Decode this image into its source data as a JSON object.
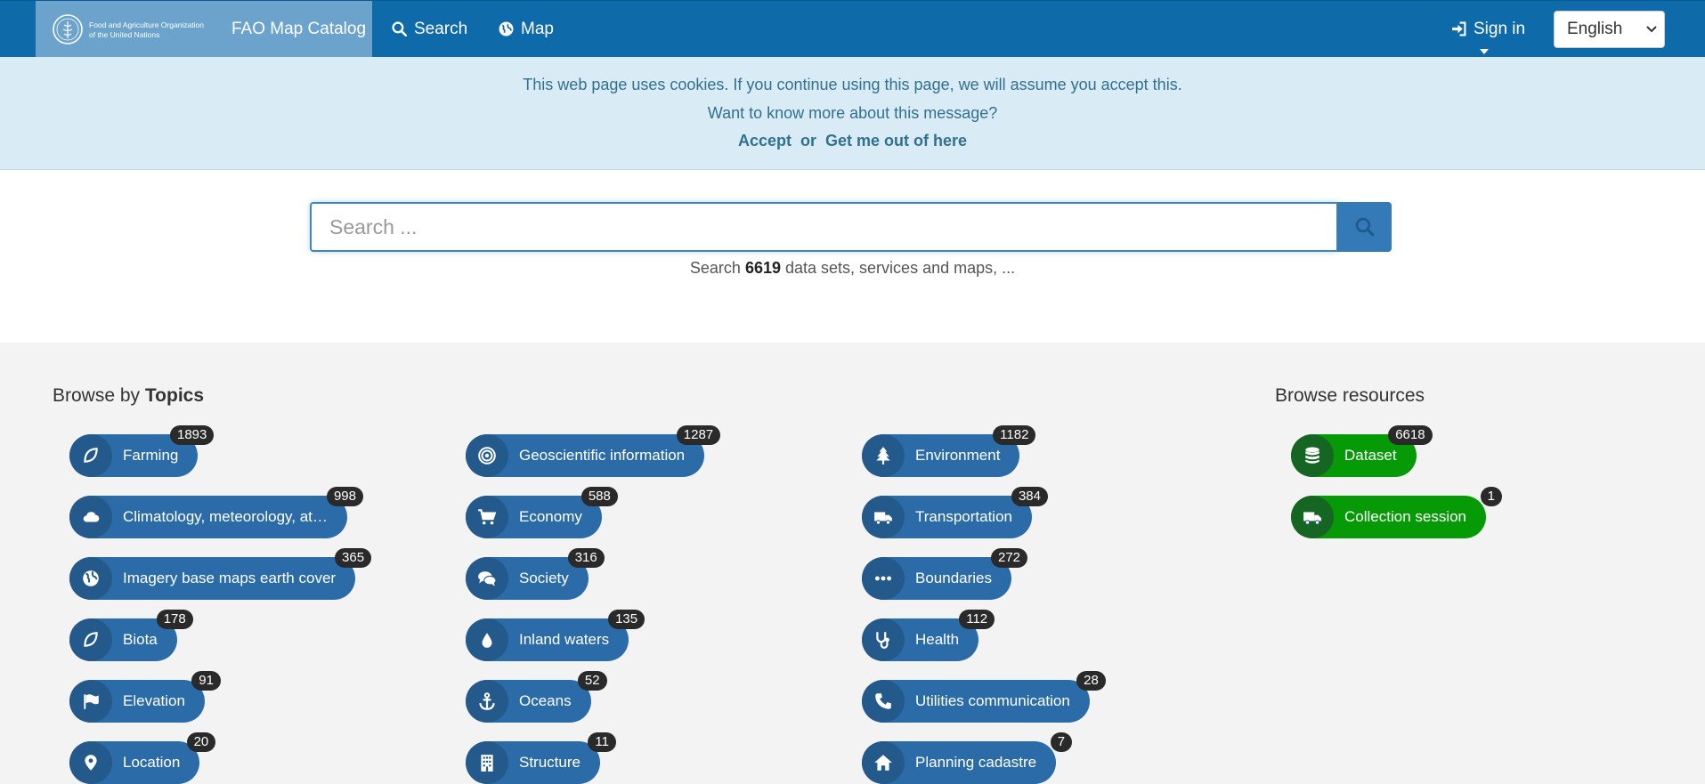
{
  "nav": {
    "org_name_line1": "Food and Agriculture Organization",
    "org_name_line2": "of the United Nations",
    "brand_title": "FAO Map Catalog",
    "search_label": "Search",
    "map_label": "Map",
    "signin_label": "Sign in",
    "language": "English",
    "bar_color": "#0e6aa8"
  },
  "cookie_banner": {
    "message": "This web page uses cookies. If you continue using this page, we will assume you accept this.",
    "more_link": "Want to know more about this message?",
    "accept_label": "Accept",
    "or_text": "or",
    "leave_label": "Get me out of here"
  },
  "search": {
    "placeholder": "Search ...",
    "hint_prefix": "Search",
    "count": "6619",
    "hint_suffix": "data sets, services and maps, ..."
  },
  "topics": {
    "title_prefix": "Browse by",
    "title_bold": "Topics",
    "items": [
      {
        "label": "Farming",
        "count": "1893",
        "icon": "leaf-icon"
      },
      {
        "label": "Climatology, meteorology, atm...",
        "count": "998",
        "icon": "cloud-icon"
      },
      {
        "label": "Imagery base maps earth cover",
        "count": "365",
        "icon": "globe-icon"
      },
      {
        "label": "Biota",
        "count": "178",
        "icon": "leaf-icon"
      },
      {
        "label": "Elevation",
        "count": "91",
        "icon": "flag-icon"
      },
      {
        "label": "Location",
        "count": "20",
        "icon": "map-marker-icon"
      },
      {
        "label": "Geoscientific information",
        "count": "1287",
        "icon": "bullseye-icon"
      },
      {
        "label": "Economy",
        "count": "588",
        "icon": "cart-icon"
      },
      {
        "label": "Society",
        "count": "316",
        "icon": "comments-icon"
      },
      {
        "label": "Inland waters",
        "count": "135",
        "icon": "drop-icon"
      },
      {
        "label": "Oceans",
        "count": "52",
        "icon": "anchor-icon"
      },
      {
        "label": "Structure",
        "count": "11",
        "icon": "building-icon"
      },
      {
        "label": "Environment",
        "count": "1182",
        "icon": "tree-icon"
      },
      {
        "label": "Transportation",
        "count": "384",
        "icon": "truck-icon"
      },
      {
        "label": "Boundaries",
        "count": "272",
        "icon": "ellipsis-icon"
      },
      {
        "label": "Health",
        "count": "112",
        "icon": "stethoscope-icon"
      },
      {
        "label": "Utilities communication",
        "count": "28",
        "icon": "phone-icon"
      },
      {
        "label": "Planning cadastre",
        "count": "7",
        "icon": "home-icon"
      }
    ]
  },
  "resources": {
    "title": "Browse resources",
    "items": [
      {
        "label": "Dataset",
        "count": "6618",
        "icon": "database-icon"
      },
      {
        "label": "Collection session",
        "count": "1",
        "icon": "truck-icon"
      }
    ]
  }
}
